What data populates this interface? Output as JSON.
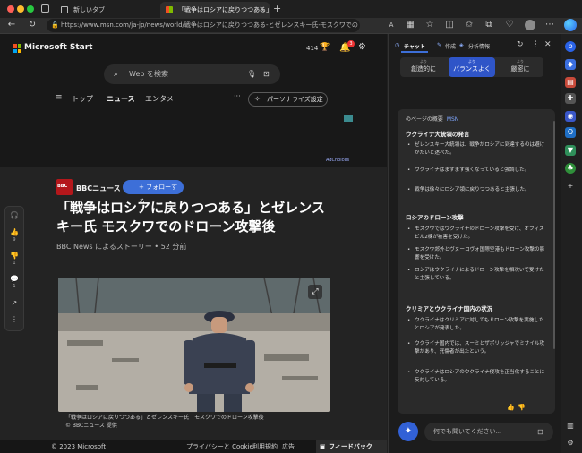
{
  "tabs": [
    {
      "label": "新しいタブ",
      "active": false
    },
    {
      "label": "「戦争はロシアに戻りつつある」とゼレ…",
      "active": true
    }
  ],
  "address_bar": {
    "url": "https://www.msn.com/ja-jp/news/world/戦争はロシアに戻りつつある-とゼレンスキー氏-モスクワでのドローン攻撃..."
  },
  "msn": {
    "brand": "Microsoft Start",
    "temperature_label": "414",
    "notification_count": "3",
    "search_placeholder": "Web を検索",
    "nav": [
      "トップ",
      "ニュース",
      "エンタメ"
    ],
    "nav_more": "···",
    "personalize_label": "パーソナライズ設定",
    "adchoices_label": "AdChoices"
  },
  "article": {
    "source_badge": "BBC",
    "source_name": "BBCニュース",
    "follow_label": "+ フォローする",
    "headline": "「戦争はロシアに戻りつつある」とゼレンスキー氏 モスクワでのドローン攻撃後",
    "byline": "BBC News によるストーリー • 52 分前",
    "caption_line1": "「戦争はロシアに戻りつつある」とゼレンスキー氏　モスクワでのドローン攻撃後",
    "caption_line2": "© BBCニュース 提供",
    "float_counts": {
      "likes": "9",
      "dislikes": "1",
      "comments": "1"
    }
  },
  "footer": {
    "copyright": "© 2023 Microsoft",
    "links": [
      "プライバシーと Cookie",
      "利用規約",
      "広告"
    ],
    "feedback_label": "フィードバック"
  },
  "sidebar": {
    "tabs": [
      "チャット",
      "作成",
      "分析情報"
    ],
    "modes": [
      {
        "small": "より",
        "label": "創造的に",
        "selected": false
      },
      {
        "small": "より",
        "label": "バランスよく",
        "selected": true
      },
      {
        "small": "より",
        "label": "厳密に",
        "selected": false
      }
    ],
    "summary_header": "のページの概要",
    "summary_source": "MSN",
    "sections": [
      {
        "title": "ウクライナ大統領の発言",
        "bullets": [
          "ゼレンスキー大統領は、戦争がロシアに到達するのは避けがたいと述べた。",
          "ウクライナはますます強くなっていると強調した。",
          "戦争は徐々にロシア領に戻りつつあると主張した。"
        ]
      },
      {
        "title": "ロシアのドローン攻撃",
        "bullets": [
          "モスクワではウクライナのドローン攻撃を受け、オフィスビル2棟が被害を受けた。",
          "モスクワ郊外とヴヌーコヴォ国際空港もドローン攻撃の影響を受けた。",
          "ロシアはウクライナによるドローン攻撃を相次いで受けたと主張している。"
        ]
      },
      {
        "title": "クリミアとウクライナ国内の状況",
        "bullets": [
          "ウクライナはクリミアに対してもドローン攻撃を実施したとロシアが発表した。",
          "ウクライナ国内では、スーミとザポリッジャでミサイル攻撃があり、死傷者が出たという。",
          "ウクライナはロシアのウクライナ侵攻を正当化することに反対している。"
        ]
      }
    ],
    "input_placeholder": "何でも聞いてください..."
  },
  "colors": {
    "accent": "#3d6fd8",
    "sidebar_selected": "#2f55c8",
    "bbc_red": "#b4171b"
  }
}
